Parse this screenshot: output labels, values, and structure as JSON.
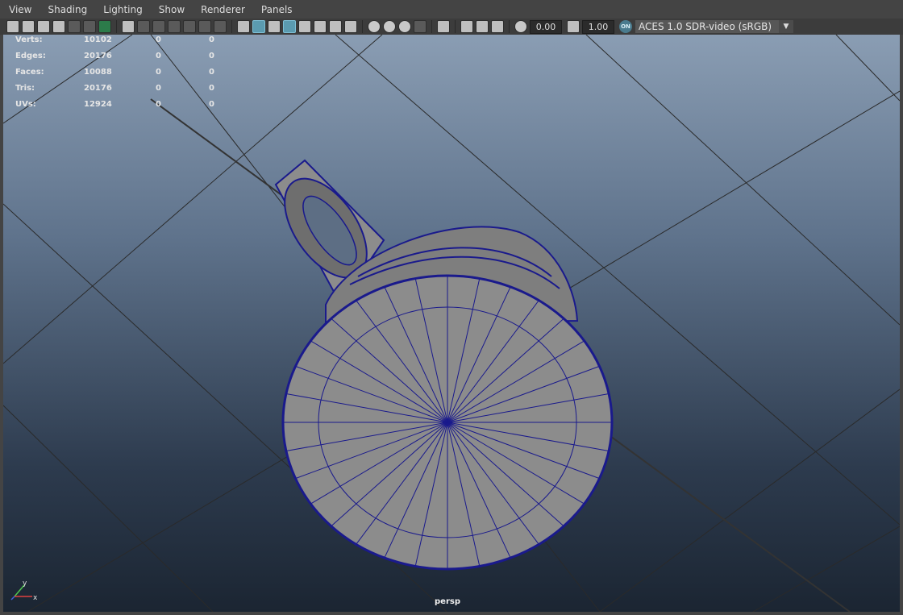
{
  "menubar": {
    "items": [
      {
        "label": "View"
      },
      {
        "label": "Shading"
      },
      {
        "label": "Lighting"
      },
      {
        "label": "Show"
      },
      {
        "label": "Renderer"
      },
      {
        "label": "Panels"
      }
    ]
  },
  "toolbar": {
    "exposure": "0.00",
    "gamma": "1.00",
    "color_mgmt_badge": "ON",
    "color_space": "ACES 1.0 SDR-video (sRGB)"
  },
  "stats": {
    "rows": [
      {
        "label": "Verts:",
        "v1": "10102",
        "v2": "0",
        "v3": "0"
      },
      {
        "label": "Edges:",
        "v1": "20176",
        "v2": "0",
        "v3": "0"
      },
      {
        "label": "Faces:",
        "v1": "10088",
        "v2": "0",
        "v3": "0"
      },
      {
        "label": "Tris:",
        "v1": "20176",
        "v2": "0",
        "v3": "0"
      },
      {
        "label": "UVs:",
        "v1": "12924",
        "v2": "0",
        "v3": "0"
      }
    ]
  },
  "viewport": {
    "camera": "persp",
    "axes": {
      "x": "x",
      "y": "y"
    }
  },
  "colors": {
    "wire": "#1a1a8c",
    "mesh_fill": "#8c8c8c",
    "grid": "#2a2a2a"
  }
}
